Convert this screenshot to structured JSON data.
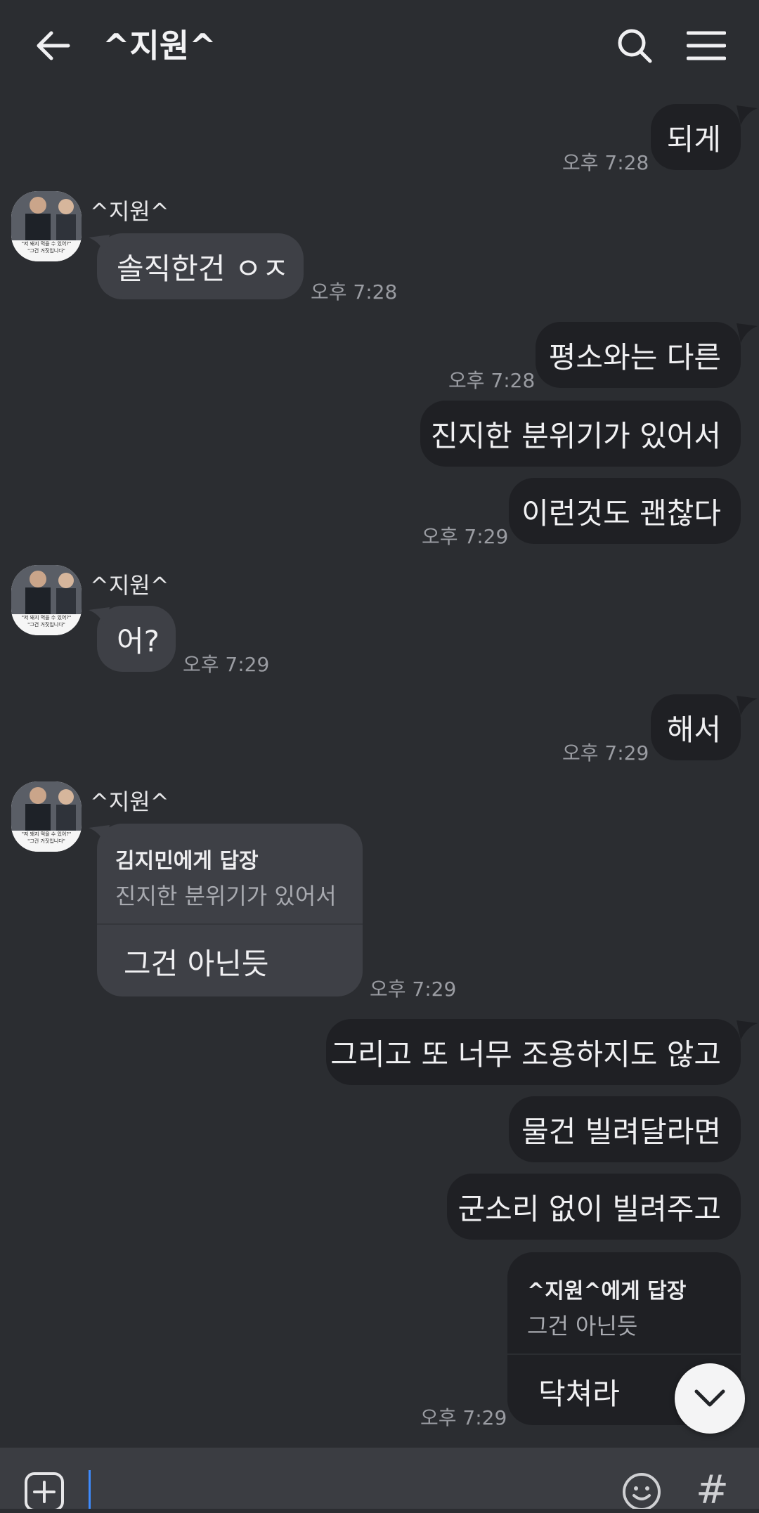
{
  "header": {
    "title": "^지원^",
    "back_icon": "arrow-left-icon",
    "search_icon": "search-icon",
    "menu_icon": "hamburger-menu-icon"
  },
  "messages": [
    {
      "dir": "out",
      "text": "되게",
      "time": "오후 7:28"
    },
    {
      "dir": "in",
      "sender": "^지원^",
      "text": "솔직한건 ㅇㅈ",
      "time": "오후 7:28"
    },
    {
      "dir": "out",
      "text": "평소와는 다른",
      "time": "오후 7:28"
    },
    {
      "dir": "out",
      "text": "진지한 분위기가 있어서"
    },
    {
      "dir": "out",
      "text": "이런것도 괜찮다",
      "time": "오후 7:29"
    },
    {
      "dir": "in",
      "sender": "^지원^",
      "text": "어?",
      "time": "오후 7:29"
    },
    {
      "dir": "out",
      "text": "해서",
      "time": "오후 7:29"
    },
    {
      "dir": "in",
      "sender": "^지원^",
      "reply_to": "김지민에게 답장",
      "quote": "진지한 분위기가 있어서",
      "text": "그건 아닌듯",
      "time": "오후 7:29"
    },
    {
      "dir": "out",
      "text": "그리고 또 너무 조용하지도 않고"
    },
    {
      "dir": "out",
      "text": "물건 빌려달라면"
    },
    {
      "dir": "out",
      "text": "군소리 없이 빌려주고"
    },
    {
      "dir": "out",
      "reply_to": "^지원^에게 답장",
      "quote": "그건 아닌듯",
      "text": "닥쳐라",
      "time": "오후 7:29"
    }
  ],
  "avatar_caption": [
    "\"저 돼지 먹을 수 있어?\"",
    "\"그건 거짓입니다\""
  ],
  "input": {
    "plus_icon": "add-plus-icon",
    "emoji_icon": "emoji-icon",
    "hash_label": "#"
  },
  "scroll_fab_icon": "chevron-down-icon",
  "colors": {
    "background": "#2b2d31",
    "bubble_out": "#1f2024",
    "bubble_in": "#3e4046",
    "time_text": "#9a9ca2",
    "cursor": "#3d8bff"
  }
}
